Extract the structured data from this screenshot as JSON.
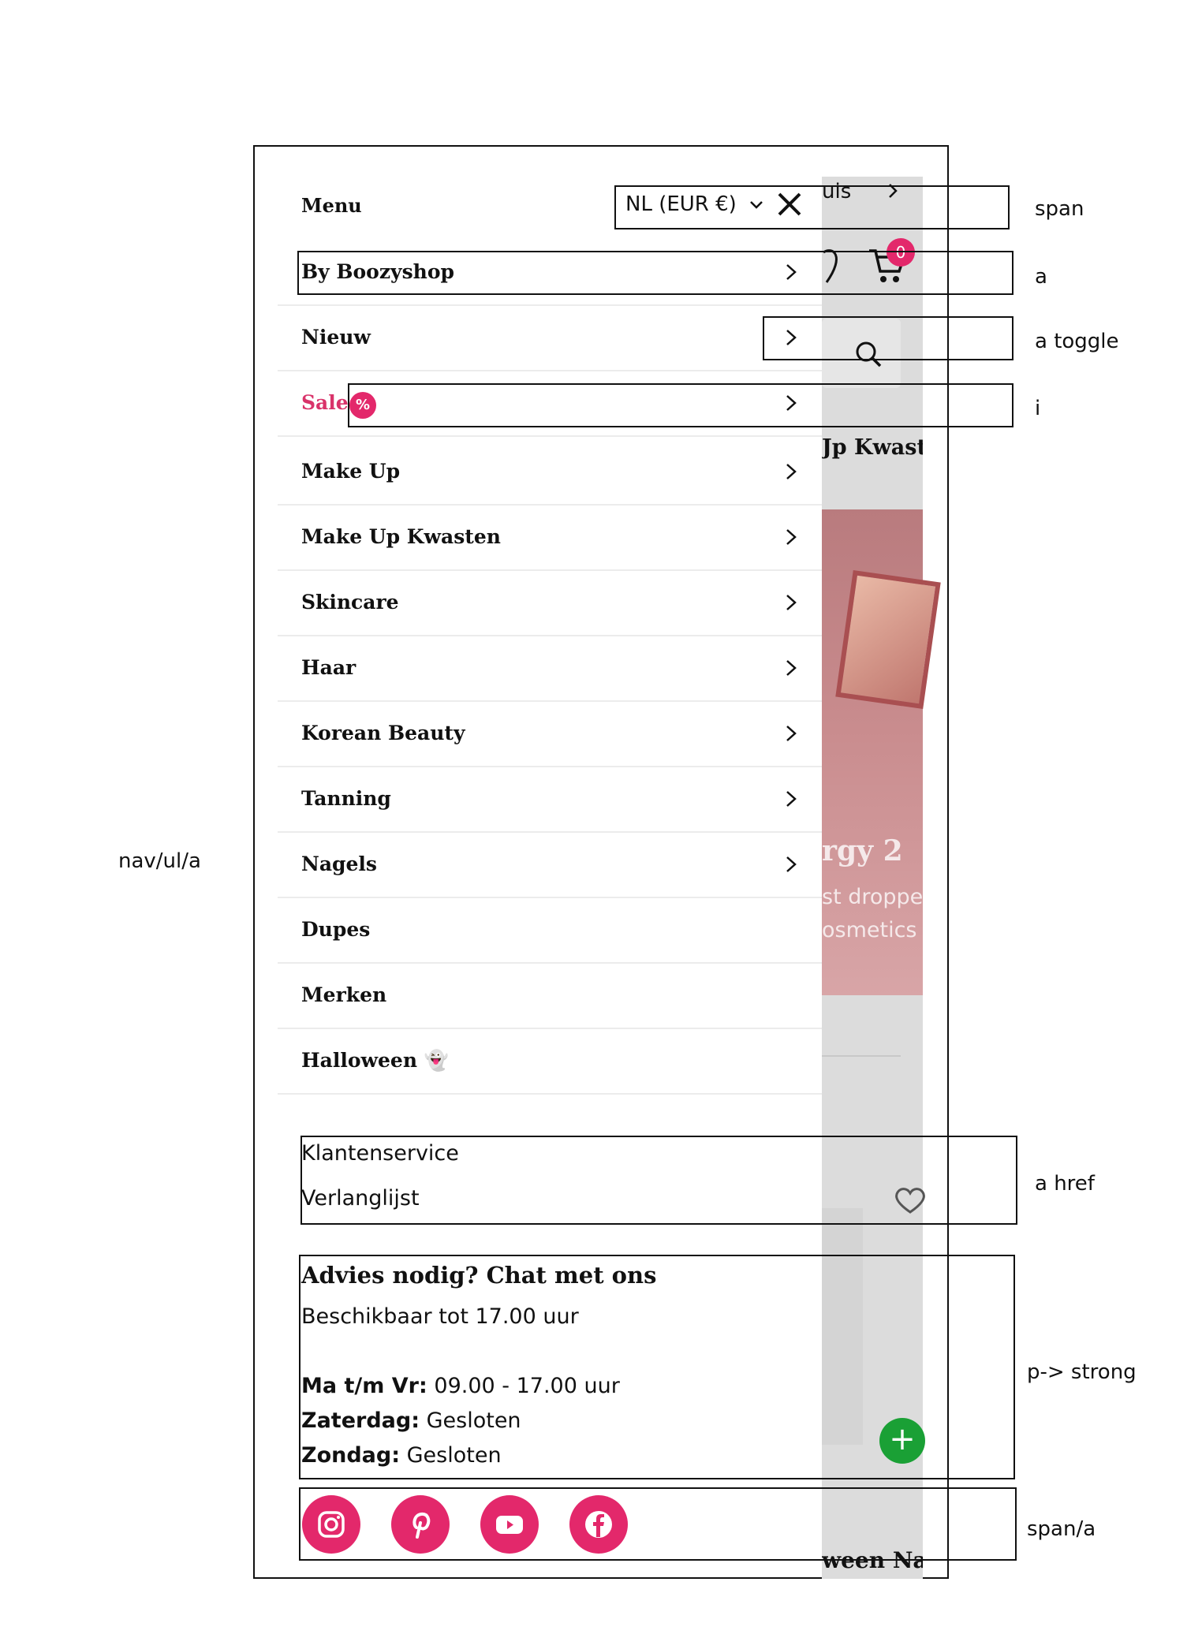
{
  "drawer": {
    "title": "Menu",
    "currency": "NL (EUR €)",
    "items": [
      {
        "label": "By Boozyshop"
      },
      {
        "label": "Nieuw"
      },
      {
        "label": "Sale",
        "badge": "%"
      },
      {
        "label": "Make Up"
      },
      {
        "label": "Make Up Kwasten"
      },
      {
        "label": "Skincare"
      },
      {
        "label": "Haar"
      },
      {
        "label": "Korean Beauty"
      },
      {
        "label": "Tanning"
      },
      {
        "label": "Nagels"
      },
      {
        "label": "Dupes"
      },
      {
        "label": "Merken"
      },
      {
        "label": "Halloween 👻"
      }
    ],
    "links": [
      "Klantenservice",
      "Verlanglijst"
    ],
    "help": {
      "title": "Advies nodig? Chat met ons",
      "subtitle": "Beschikbaar tot 17.00 uur",
      "hours": [
        {
          "day": "Ma t/m Vr:",
          "time": "09.00 - 17.00 uur"
        },
        {
          "day": "Zaterdag:",
          "time": "Gesloten"
        },
        {
          "day": "Zondag:",
          "time": "Gesloten"
        }
      ]
    },
    "socials": [
      "instagram-icon",
      "pinterest-icon",
      "youtube-icon",
      "facebook-icon"
    ]
  },
  "background": {
    "breadcrumb": "uis",
    "cart_count": "0",
    "heading": "Jp Kwast",
    "banner_title": "rgy 2",
    "banner_line1": "st dropped",
    "banner_line2": "osmetics",
    "bottom_text": "ween Nail"
  },
  "annotations": {
    "span": "span",
    "a": "a",
    "a_toggle": "a toggle",
    "i": "i",
    "nav": "nav/ul/a",
    "a_href": "a href",
    "p_strong": "p-> strong",
    "span_a": "span/a"
  },
  "colors": {
    "accent": "#e3286b",
    "sale": "#d9336a",
    "chat": "#1aa035"
  }
}
